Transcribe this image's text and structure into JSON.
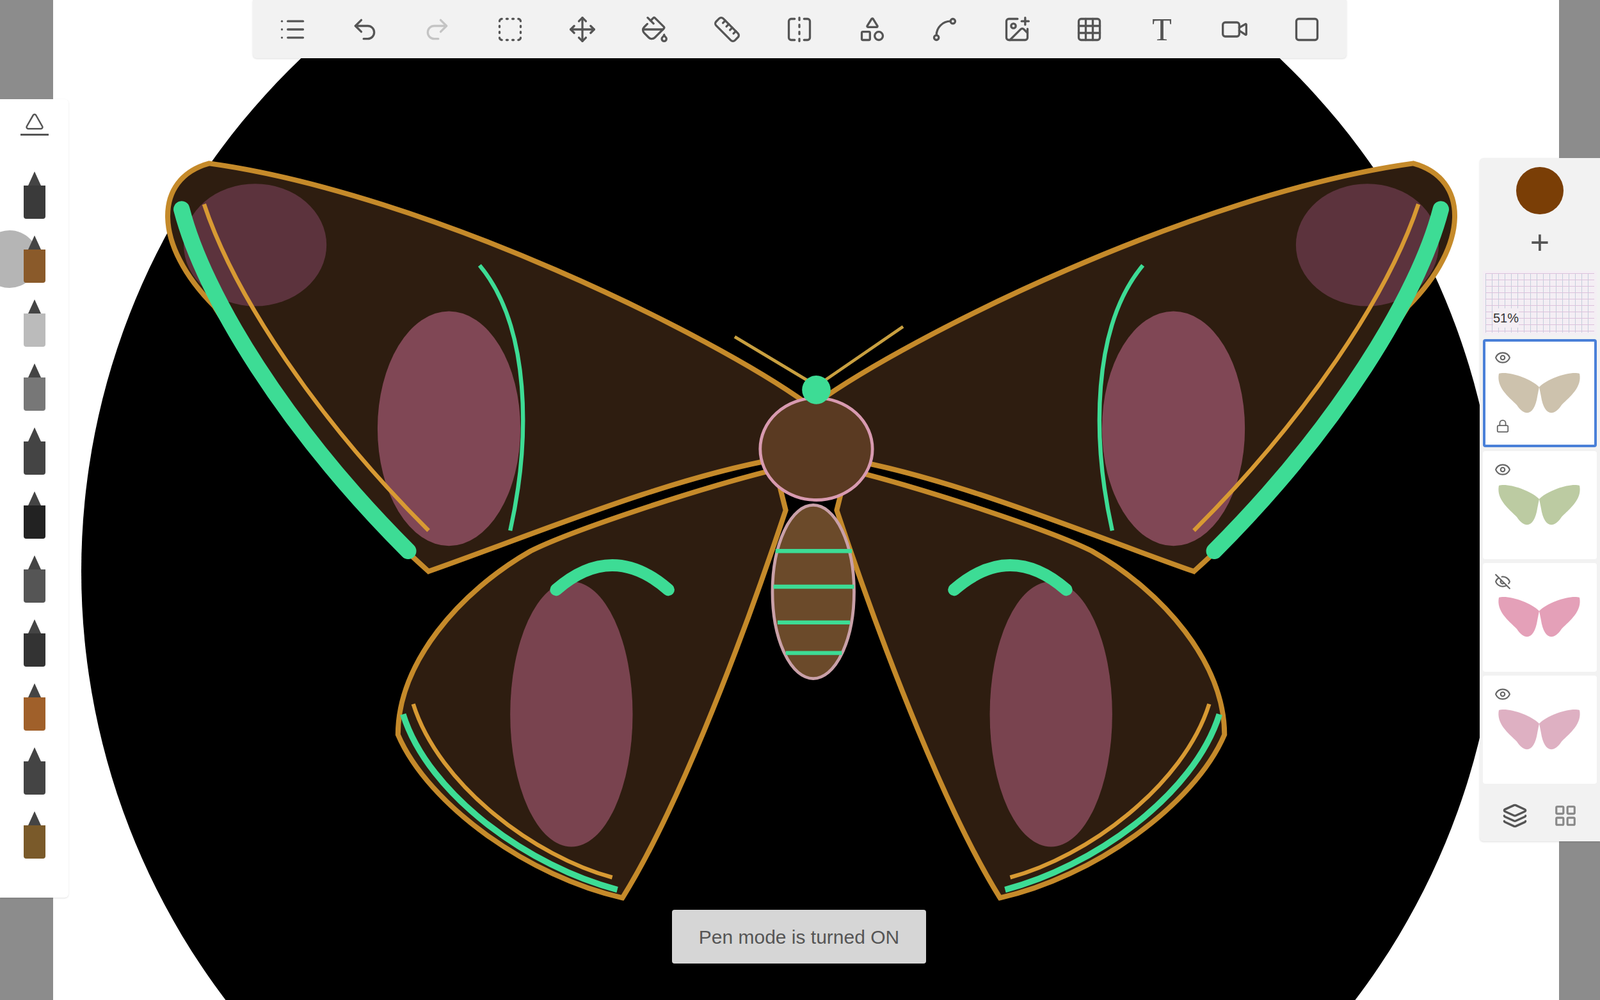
{
  "toolbar": {
    "text_tool_glyph": "T",
    "undo_disabled": false,
    "redo_disabled": true
  },
  "brushes": [
    {
      "selected": false
    },
    {
      "selected": true
    },
    {
      "selected": false
    },
    {
      "selected": false
    },
    {
      "selected": false
    },
    {
      "selected": false
    },
    {
      "selected": false
    },
    {
      "selected": false
    },
    {
      "selected": false
    },
    {
      "selected": false
    },
    {
      "selected": false
    }
  ],
  "color_panel": {
    "current_color": "#7a3e06",
    "add_layer": "+"
  },
  "layers": [
    {
      "kind": "grid",
      "opacity": "51%",
      "visible": true,
      "selected": false,
      "locked": false,
      "color": "#c9a6d6"
    },
    {
      "kind": "art",
      "visible": true,
      "selected": true,
      "locked": true,
      "color": "#b8a88a"
    },
    {
      "kind": "art",
      "visible": true,
      "selected": false,
      "locked": false,
      "color": "#9fb57a"
    },
    {
      "kind": "art",
      "visible": false,
      "selected": false,
      "locked": false,
      "color": "#d9789a"
    },
    {
      "kind": "art",
      "visible": true,
      "selected": false,
      "locked": false,
      "color": "#d08fa8"
    }
  ],
  "toast": {
    "text": "Pen mode is turned ON"
  }
}
